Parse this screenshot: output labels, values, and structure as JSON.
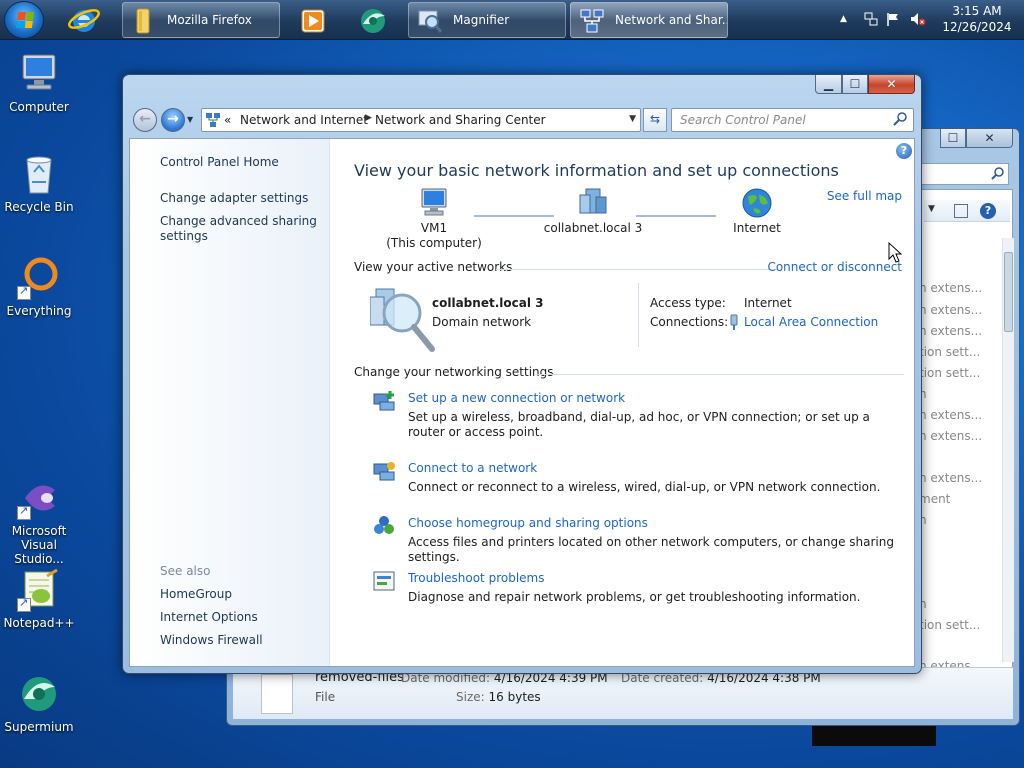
{
  "taskbar": {
    "windows": [
      {
        "label": "Mozilla Firefox",
        "icon": "folder-icon"
      },
      {
        "label": "Magnifier",
        "icon": "magnifier-icon"
      },
      {
        "label": "Network and Shar...",
        "icon": "network-icon"
      }
    ],
    "clock": {
      "time": "3:15 AM",
      "date": "12/26/2024"
    }
  },
  "desktop": {
    "icons": [
      {
        "label": "Computer"
      },
      {
        "label": "Recycle Bin"
      },
      {
        "label": "Everything"
      },
      {
        "label": "Microsoft Visual Studio..."
      },
      {
        "label": "Notepad++"
      },
      {
        "label": "Supermium"
      }
    ]
  },
  "background_window": {
    "list_items": [
      "n extens...",
      "n extens...",
      "n extens...",
      "tion sett...",
      "tion sett...",
      "n",
      "n extens...",
      "n extens...",
      "n extens...",
      "ment",
      "n",
      "n",
      "tion sett...",
      "n extens..."
    ],
    "details": {
      "file_name": "removed-files",
      "file_type": "File",
      "modified_label": "Date modified:",
      "modified_value": "4/16/2024 4:39 PM",
      "created_label": "Date created:",
      "created_value": "4/16/2024 4:38 PM",
      "size_label": "Size:",
      "size_value": "16 bytes"
    }
  },
  "window": {
    "address": {
      "overflow": "«",
      "crumbs": [
        "Network and Internet",
        "Network and Sharing Center"
      ]
    },
    "search_placeholder": "Search Control Panel",
    "left_pane": {
      "home": "Control Panel Home",
      "links": [
        "Change adapter settings",
        "Change advanced sharing settings"
      ],
      "see_also_heading": "See also",
      "see_also": [
        "HomeGroup",
        "Internet Options",
        "Windows Firewall"
      ]
    },
    "main": {
      "title": "View your basic network information and set up connections",
      "see_full_map": "See full map",
      "map": {
        "computer_name": "VM1",
        "computer_sub": "(This computer)",
        "network": "collabnet.local  3",
        "internet": "Internet"
      },
      "active_networks": {
        "heading": "View your active networks",
        "connect_link": "Connect or disconnect",
        "network_name": "collabnet.local  3",
        "network_type": "Domain network",
        "access_type_label": "Access type:",
        "access_type_value": "Internet",
        "connections_label": "Connections:",
        "connections_value": "Local Area Connection"
      },
      "settings": {
        "heading": "Change your networking settings",
        "tasks": [
          {
            "link": "Set up a new connection or network",
            "desc": "Set up a wireless, broadband, dial-up, ad hoc, or VPN connection; or set up a router or access point.",
            "icon": "new-connection-icon"
          },
          {
            "link": "Connect to a network",
            "desc": "Connect or reconnect to a wireless, wired, dial-up, or VPN network connection.",
            "icon": "connect-network-icon"
          },
          {
            "link": "Choose homegroup and sharing options",
            "desc": "Access files and printers located on other network computers, or change sharing settings.",
            "icon": "homegroup-icon"
          },
          {
            "link": "Troubleshoot problems",
            "desc": "Diagnose and repair network problems, or get troubleshooting information.",
            "icon": "troubleshoot-icon"
          }
        ]
      }
    }
  }
}
